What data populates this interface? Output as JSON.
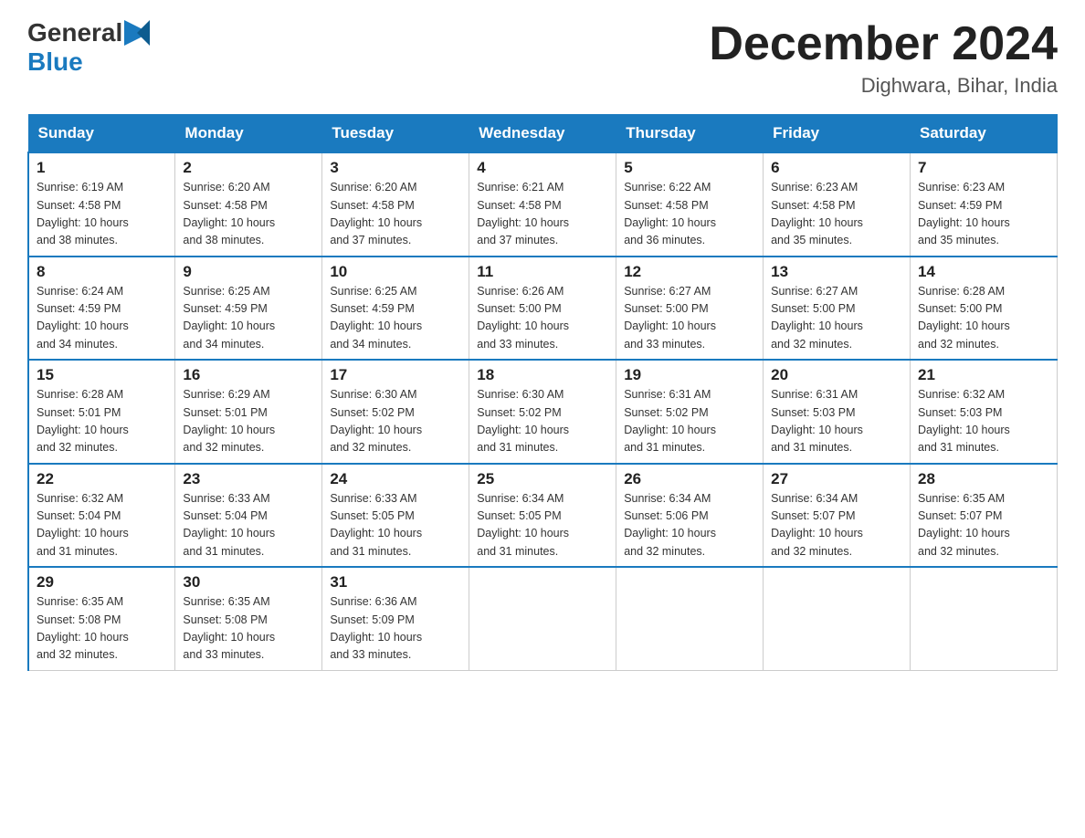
{
  "header": {
    "logo_general": "General",
    "logo_blue": "Blue",
    "title": "December 2024",
    "location": "Dighwara, Bihar, India"
  },
  "weekdays": [
    "Sunday",
    "Monday",
    "Tuesday",
    "Wednesday",
    "Thursday",
    "Friday",
    "Saturday"
  ],
  "weeks": [
    [
      {
        "day": "1",
        "sunrise": "6:19 AM",
        "sunset": "4:58 PM",
        "daylight": "10 hours and 38 minutes."
      },
      {
        "day": "2",
        "sunrise": "6:20 AM",
        "sunset": "4:58 PM",
        "daylight": "10 hours and 38 minutes."
      },
      {
        "day": "3",
        "sunrise": "6:20 AM",
        "sunset": "4:58 PM",
        "daylight": "10 hours and 37 minutes."
      },
      {
        "day": "4",
        "sunrise": "6:21 AM",
        "sunset": "4:58 PM",
        "daylight": "10 hours and 37 minutes."
      },
      {
        "day": "5",
        "sunrise": "6:22 AM",
        "sunset": "4:58 PM",
        "daylight": "10 hours and 36 minutes."
      },
      {
        "day": "6",
        "sunrise": "6:23 AM",
        "sunset": "4:58 PM",
        "daylight": "10 hours and 35 minutes."
      },
      {
        "day": "7",
        "sunrise": "6:23 AM",
        "sunset": "4:59 PM",
        "daylight": "10 hours and 35 minutes."
      }
    ],
    [
      {
        "day": "8",
        "sunrise": "6:24 AM",
        "sunset": "4:59 PM",
        "daylight": "10 hours and 34 minutes."
      },
      {
        "day": "9",
        "sunrise": "6:25 AM",
        "sunset": "4:59 PM",
        "daylight": "10 hours and 34 minutes."
      },
      {
        "day": "10",
        "sunrise": "6:25 AM",
        "sunset": "4:59 PM",
        "daylight": "10 hours and 34 minutes."
      },
      {
        "day": "11",
        "sunrise": "6:26 AM",
        "sunset": "5:00 PM",
        "daylight": "10 hours and 33 minutes."
      },
      {
        "day": "12",
        "sunrise": "6:27 AM",
        "sunset": "5:00 PM",
        "daylight": "10 hours and 33 minutes."
      },
      {
        "day": "13",
        "sunrise": "6:27 AM",
        "sunset": "5:00 PM",
        "daylight": "10 hours and 32 minutes."
      },
      {
        "day": "14",
        "sunrise": "6:28 AM",
        "sunset": "5:00 PM",
        "daylight": "10 hours and 32 minutes."
      }
    ],
    [
      {
        "day": "15",
        "sunrise": "6:28 AM",
        "sunset": "5:01 PM",
        "daylight": "10 hours and 32 minutes."
      },
      {
        "day": "16",
        "sunrise": "6:29 AM",
        "sunset": "5:01 PM",
        "daylight": "10 hours and 32 minutes."
      },
      {
        "day": "17",
        "sunrise": "6:30 AM",
        "sunset": "5:02 PM",
        "daylight": "10 hours and 32 minutes."
      },
      {
        "day": "18",
        "sunrise": "6:30 AM",
        "sunset": "5:02 PM",
        "daylight": "10 hours and 31 minutes."
      },
      {
        "day": "19",
        "sunrise": "6:31 AM",
        "sunset": "5:02 PM",
        "daylight": "10 hours and 31 minutes."
      },
      {
        "day": "20",
        "sunrise": "6:31 AM",
        "sunset": "5:03 PM",
        "daylight": "10 hours and 31 minutes."
      },
      {
        "day": "21",
        "sunrise": "6:32 AM",
        "sunset": "5:03 PM",
        "daylight": "10 hours and 31 minutes."
      }
    ],
    [
      {
        "day": "22",
        "sunrise": "6:32 AM",
        "sunset": "5:04 PM",
        "daylight": "10 hours and 31 minutes."
      },
      {
        "day": "23",
        "sunrise": "6:33 AM",
        "sunset": "5:04 PM",
        "daylight": "10 hours and 31 minutes."
      },
      {
        "day": "24",
        "sunrise": "6:33 AM",
        "sunset": "5:05 PM",
        "daylight": "10 hours and 31 minutes."
      },
      {
        "day": "25",
        "sunrise": "6:34 AM",
        "sunset": "5:05 PM",
        "daylight": "10 hours and 31 minutes."
      },
      {
        "day": "26",
        "sunrise": "6:34 AM",
        "sunset": "5:06 PM",
        "daylight": "10 hours and 32 minutes."
      },
      {
        "day": "27",
        "sunrise": "6:34 AM",
        "sunset": "5:07 PM",
        "daylight": "10 hours and 32 minutes."
      },
      {
        "day": "28",
        "sunrise": "6:35 AM",
        "sunset": "5:07 PM",
        "daylight": "10 hours and 32 minutes."
      }
    ],
    [
      {
        "day": "29",
        "sunrise": "6:35 AM",
        "sunset": "5:08 PM",
        "daylight": "10 hours and 32 minutes."
      },
      {
        "day": "30",
        "sunrise": "6:35 AM",
        "sunset": "5:08 PM",
        "daylight": "10 hours and 33 minutes."
      },
      {
        "day": "31",
        "sunrise": "6:36 AM",
        "sunset": "5:09 PM",
        "daylight": "10 hours and 33 minutes."
      },
      null,
      null,
      null,
      null
    ]
  ],
  "labels": {
    "sunrise": "Sunrise:",
    "sunset": "Sunset:",
    "daylight": "Daylight:"
  }
}
